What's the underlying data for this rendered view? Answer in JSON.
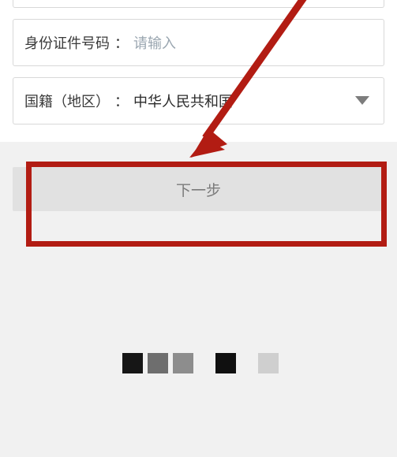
{
  "form": {
    "id_number": {
      "label": "身份证件号码",
      "separator": "：",
      "placeholder": "请输入",
      "value": ""
    },
    "nationality": {
      "label": "国籍（地区）",
      "separator": "：",
      "value": "中华人民共和国"
    }
  },
  "actions": {
    "next_label": "下一步"
  },
  "annotation": {
    "highlight_color": "#b21c13"
  }
}
